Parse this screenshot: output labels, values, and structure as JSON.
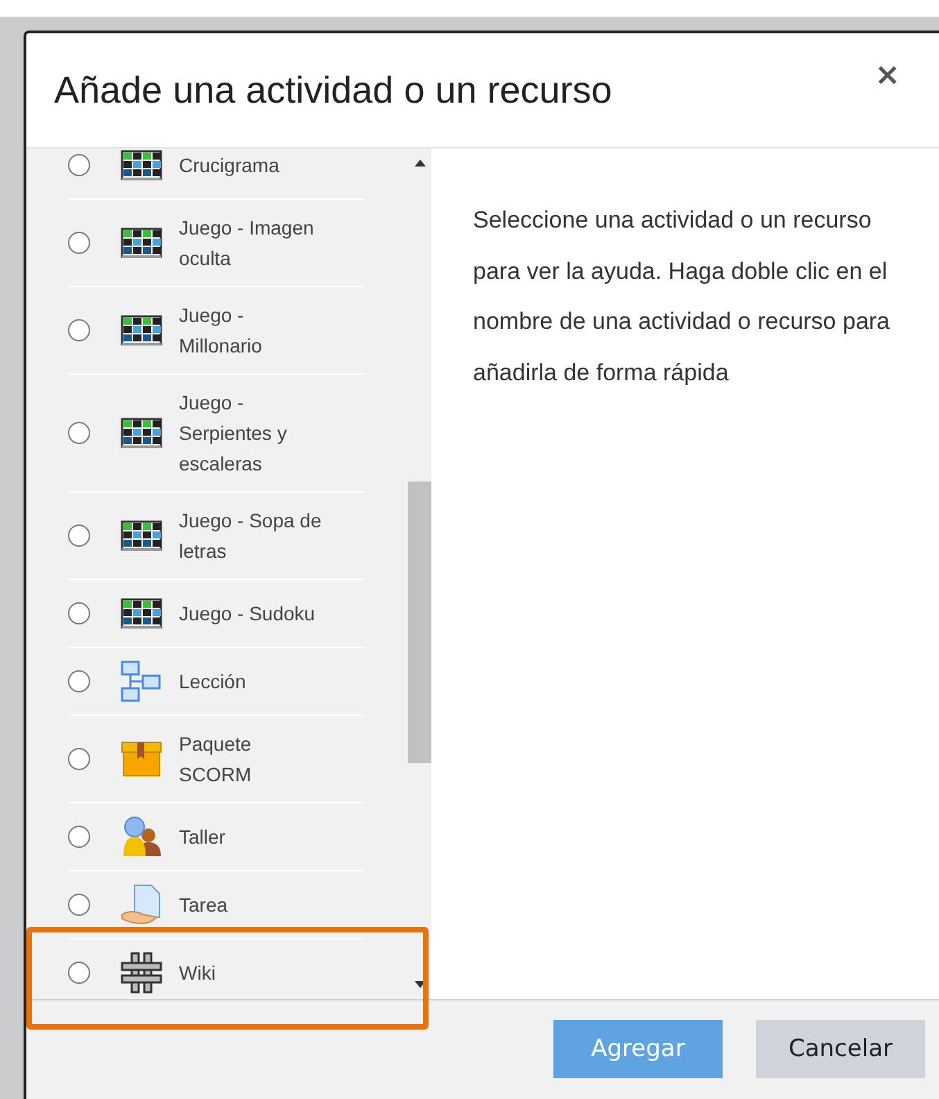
{
  "dialog": {
    "title": "Añade una actividad o un recurso",
    "close": "×"
  },
  "items": [
    {
      "label": "Crucigrama",
      "kind": "game",
      "selected": false
    },
    {
      "label": "Juego - Imagen oculta",
      "kind": "game",
      "selected": false
    },
    {
      "label": "Juego - Millonario",
      "kind": "game",
      "selected": false
    },
    {
      "label": "Juego - Serpientes y escaleras",
      "kind": "game",
      "selected": false
    },
    {
      "label": "Juego - Sopa de letras",
      "kind": "game",
      "selected": false
    },
    {
      "label": "Juego - Sudoku",
      "kind": "game",
      "selected": false
    },
    {
      "label": "Lección",
      "kind": "lesson",
      "selected": false
    },
    {
      "label": "Paquete SCORM",
      "kind": "package",
      "selected": false
    },
    {
      "label": "Taller",
      "kind": "workshop",
      "selected": false
    },
    {
      "label": "Tarea",
      "kind": "assignment",
      "selected": false
    },
    {
      "label": "Wiki",
      "kind": "wiki",
      "selected": false
    }
  ],
  "help": "Seleccione una actividad o un recurso para ver la ayuda. Haga doble clic en el nombre de una actividad o recurso para añadirla de forma rápida",
  "buttons": [
    {
      "label": "Agregar",
      "kind": "primary"
    },
    {
      "label": "Cancelar",
      "kind": "secondary"
    }
  ]
}
